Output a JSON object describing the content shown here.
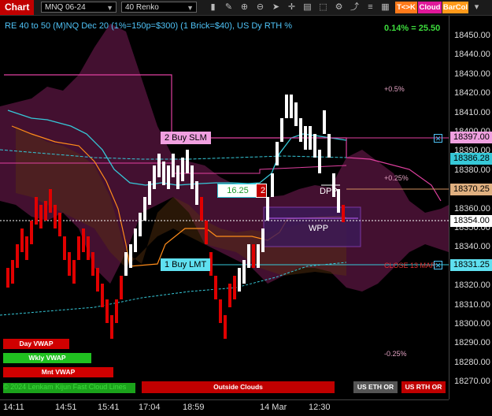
{
  "toolbar": {
    "chart_label": "Chart",
    "instrument": "MNQ 06-24",
    "period": "40 Renko",
    "tk_label": "T<>K",
    "cloud_label": "Cloud",
    "barcol_label": "BarCol"
  },
  "chart": {
    "title": "RE 40 to 50 (M)NQ Dec 20 (1%=150p=$300) (1 Brick=$40), US Dy RTH %",
    "pct_change": "0.14% = 25.50",
    "copyright": "© 2024 Lenkam Kijun Fast Cloud Lines",
    "price_ticks": [
      "18450.00",
      "18440.00",
      "18430.00",
      "18420.00",
      "18410.00",
      "18400.00",
      "18390.00",
      "18380.00",
      "18370.00",
      "18360.00",
      "18350.00",
      "18340.00",
      "18330.00",
      "18320.00",
      "18310.00",
      "18300.00",
      "18290.00",
      "18280.00",
      "18270.00"
    ],
    "time_ticks": [
      "14:11",
      "14:51",
      "15:41",
      "17:04",
      "18:59",
      "14 Mar",
      "12:30"
    ],
    "flags": {
      "buy_slm": "18397.00",
      "level_cyan": "18386.28",
      "dpp": "18370.25",
      "last": "18354.00",
      "buy_lmt": "18331.25"
    },
    "orders": {
      "sell_label": "2  Buy SLM",
      "buy_label": "1  Buy LMT",
      "qty_price": "16.25",
      "qty": "2"
    },
    "levels": {
      "plus_half": "+0.5%",
      "plus_quarter": "+0.25%",
      "minus_quarter": "-0.25%",
      "close": "CLOSE 13 MAR",
      "dpp": "DPP",
      "wpp": "WPP"
    },
    "buttons": {
      "day_vwap": "Day VWAP",
      "wkly_vwap": "Wkly VWAP",
      "mnt_vwap": "Mnt VWAP",
      "outside_clouds": "Outside Clouds",
      "us_eth_or": "US ETH OR",
      "us_rth_or": "US RTH OR"
    }
  },
  "colors": {
    "up": "#ffffff",
    "down": "#e00000",
    "cloud": "#6a1a4a",
    "cyan": "#36c8d8",
    "magenta": "#e040a0",
    "orange": "#ff8c1a"
  }
}
